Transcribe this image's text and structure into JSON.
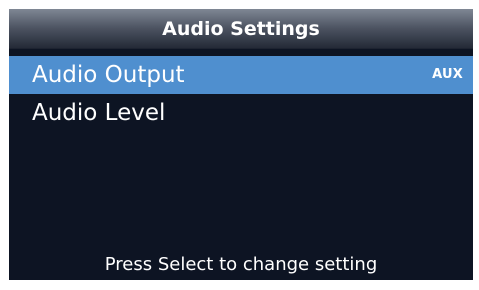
{
  "screen": {
    "title": "Audio Settings",
    "menu": {
      "items": [
        {
          "label": "Audio Output",
          "value": "AUX",
          "selected": true
        },
        {
          "label": "Audio Level",
          "value": "",
          "selected": false
        }
      ]
    },
    "footer_hint": "Press Select to change setting"
  },
  "colors": {
    "background": "#0d1423",
    "title_gradient_top": "#7f8794",
    "title_gradient_bottom": "#242a37",
    "selection": "#4f8fcf",
    "text": "#ffffff"
  }
}
